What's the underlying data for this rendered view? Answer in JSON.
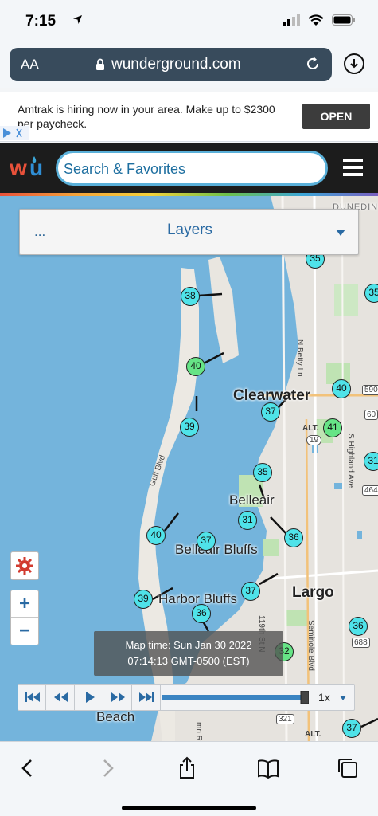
{
  "status": {
    "time": "7:15"
  },
  "browser": {
    "aa": "AA",
    "url": "wunderground.com"
  },
  "ad": {
    "text": "Amtrak is hiring now in your area. Make up to $2300 per paycheck.",
    "cta": "OPEN"
  },
  "header": {
    "search_label": "Search & Favorites"
  },
  "layers": {
    "dots": "...",
    "label": "Layers"
  },
  "map": {
    "places": [
      "Clearwater",
      "Belleair",
      "Belleair Bluffs",
      "Harbor Bluffs",
      "Largo",
      "Beach",
      "DUNEDIN"
    ],
    "roads": [
      "N Betty Ln",
      "S Highland Ave",
      "Gulf Blvd",
      "Seminole Blvd",
      "119th St N",
      "ALT.",
      "19",
      "590",
      "60",
      "464",
      "688",
      "321",
      "ALT.",
      "mn Rd"
    ],
    "temps": [
      {
        "value": "35",
        "color": "cyan"
      },
      {
        "value": "38",
        "color": "cyan"
      },
      {
        "value": "35",
        "color": "cyan"
      },
      {
        "value": "40",
        "color": "green"
      },
      {
        "value": "40",
        "color": "cyan"
      },
      {
        "value": "37",
        "color": "cyan"
      },
      {
        "value": "39",
        "color": "cyan"
      },
      {
        "value": "41",
        "color": "green"
      },
      {
        "value": "31",
        "color": "cyan"
      },
      {
        "value": "35",
        "color": "cyan"
      },
      {
        "value": "31",
        "color": "cyan"
      },
      {
        "value": "36",
        "color": "cyan"
      },
      {
        "value": "40",
        "color": "cyan"
      },
      {
        "value": "37",
        "color": "cyan"
      },
      {
        "value": "37",
        "color": "cyan"
      },
      {
        "value": "39",
        "color": "cyan"
      },
      {
        "value": "36",
        "color": "cyan"
      },
      {
        "value": "36",
        "color": "cyan"
      },
      {
        "value": "32",
        "color": "green"
      },
      {
        "value": "37",
        "color": "cyan"
      }
    ]
  },
  "zoom": {
    "in": "+",
    "out": "−"
  },
  "maptime": {
    "line1": "Map time: Sun Jan 30 2022",
    "line2": "07:14:13 GMT-0500 (EST)"
  },
  "player": {
    "speed": "1x",
    "progress": 1.0
  }
}
